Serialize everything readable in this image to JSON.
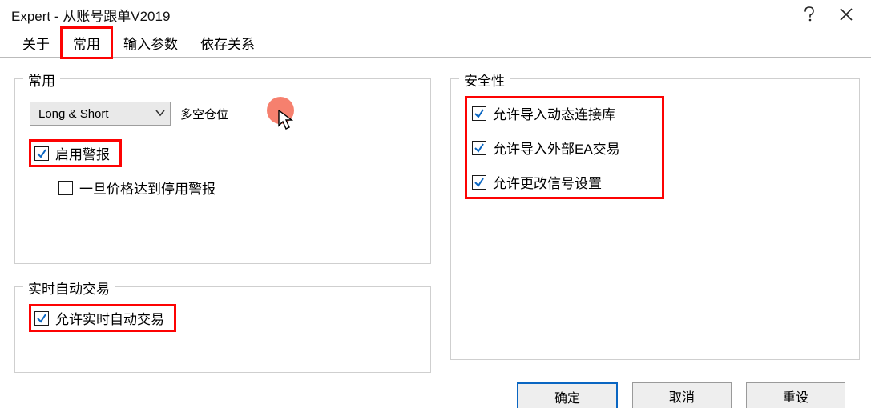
{
  "window": {
    "title": "Expert - 从账号跟单V2019"
  },
  "tabs": {
    "about": "关于",
    "common": "常用",
    "inputs": "输入参数",
    "depend": "依存关系"
  },
  "group_common": {
    "legend": "常用",
    "positions_select": "Long & Short",
    "positions_label": "多空仓位",
    "enable_alert": "启用警报",
    "disable_alert_once_hit": "一旦价格达到停用警报"
  },
  "group_auto": {
    "legend": "实时自动交易",
    "allow_live_trading": "允许实时自动交易"
  },
  "group_security": {
    "legend": "安全性",
    "allow_dll": "允许导入动态连接库",
    "allow_ext_ea": "允许导入外部EA交易",
    "allow_signal": "允许更改信号设置"
  },
  "buttons": {
    "ok": "确定",
    "cancel": "取消",
    "reset": "重设"
  },
  "checks": {
    "enable_alert": true,
    "disable_alert_once_hit": false,
    "allow_live_trading": true,
    "allow_dll": true,
    "allow_ext_ea": true,
    "allow_signal": true
  }
}
